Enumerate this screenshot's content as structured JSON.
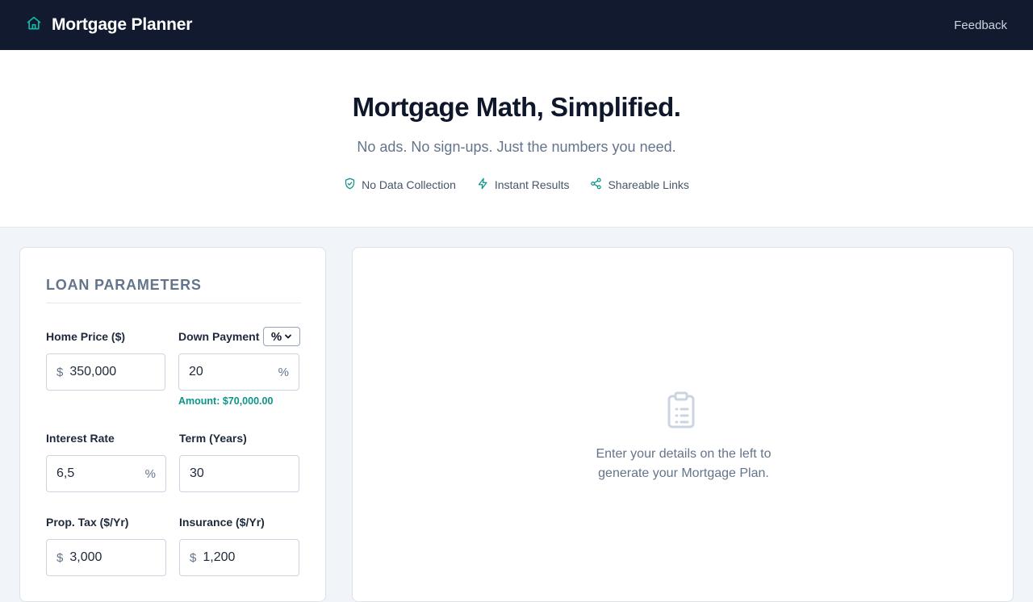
{
  "header": {
    "title": "Mortgage Planner",
    "home_icon": "home-icon",
    "feedback_label": "Feedback"
  },
  "hero": {
    "title": "Mortgage Math, Simplified.",
    "subtitle": "No ads. No sign-ups. Just the numbers you need.",
    "features": [
      {
        "icon": "shield-check-icon",
        "label": "No Data Collection"
      },
      {
        "icon": "lightning-icon",
        "label": "Instant Results"
      },
      {
        "icon": "share-icon",
        "label": "Shareable Links"
      }
    ]
  },
  "loan_parameters": {
    "title": "LOAN PARAMETERS",
    "home_price": {
      "label": "Home Price ($)",
      "prefix": "$",
      "value": "350,000"
    },
    "down_payment": {
      "label": "Down Payment",
      "unit_selected": "%",
      "value": "20",
      "suffix": "%",
      "amount_hint": "Amount: $70,000.00"
    },
    "interest_rate": {
      "label": "Interest Rate",
      "value": "6,5",
      "suffix": "%"
    },
    "term": {
      "label": "Term (Years)",
      "value": "30"
    },
    "prop_tax": {
      "label": "Prop. Tax ($/Yr)",
      "prefix": "$",
      "value": "3,000"
    },
    "insurance": {
      "label": "Insurance ($/Yr)",
      "prefix": "$",
      "value": "1,200"
    }
  },
  "results": {
    "empty_icon": "clipboard-icon",
    "empty_line1": "Enter your details on the left to",
    "empty_line2": "generate your Mortgage Plan."
  },
  "colors": {
    "navbar": "#111a2e",
    "accent": "#0d9488",
    "muted_text": "#64748b"
  }
}
